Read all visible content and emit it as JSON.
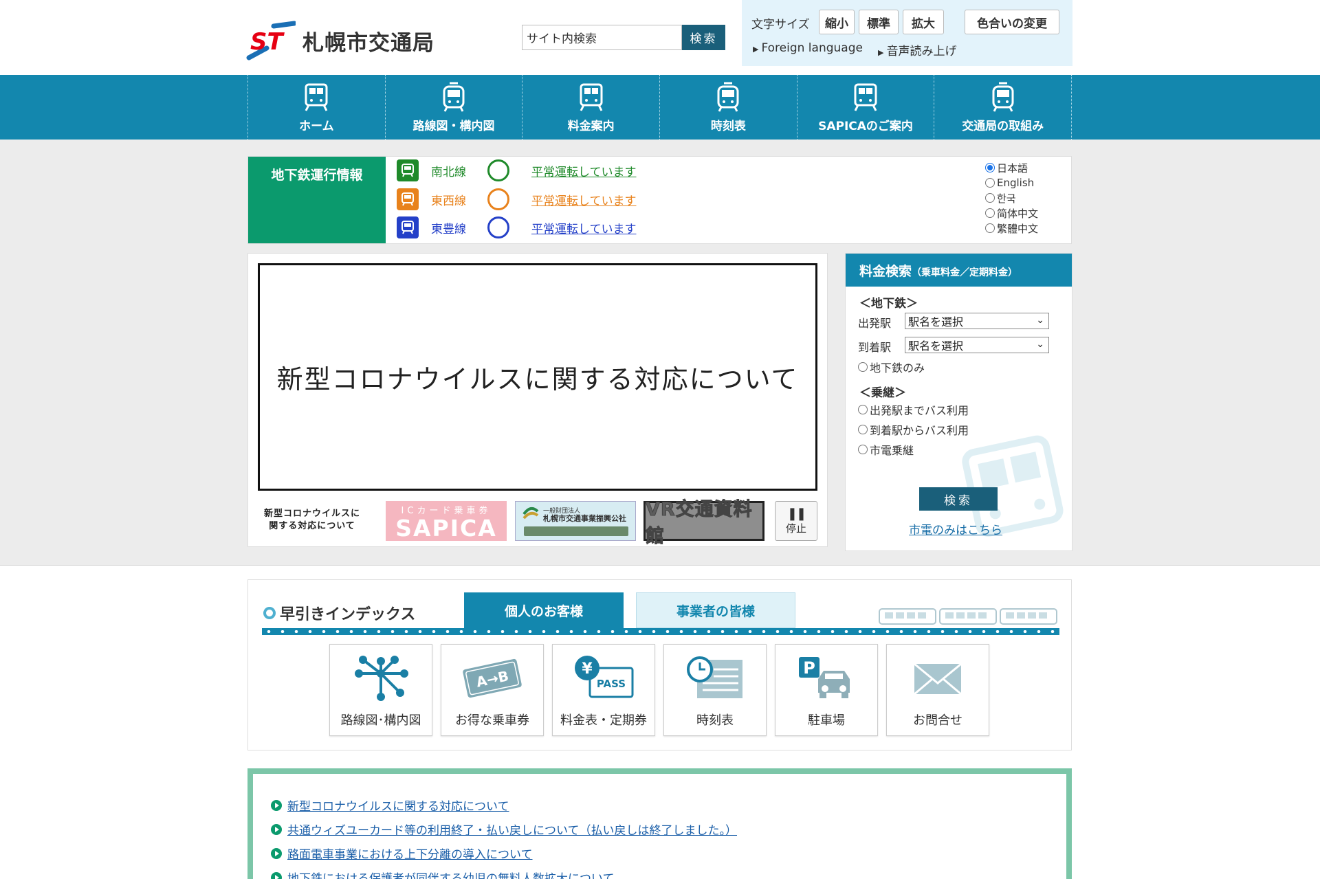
{
  "header": {
    "site_name": "札幌市交通局",
    "logo_letters": "ST",
    "search": {
      "placeholder": "サイト内検索",
      "value": "サイト内検索",
      "button": "検索"
    },
    "font_size": {
      "label": "文字サイズ",
      "small": "縮小",
      "standard": "標準",
      "large": "拡大"
    },
    "color_change": "色合いの変更",
    "foreign_language": "Foreign language",
    "read_aloud": "音声読み上げ"
  },
  "nav": {
    "items": [
      {
        "label": "ホーム",
        "icon": "subway-car-icon"
      },
      {
        "label": "路線図・構内図",
        "icon": "streetcar-icon"
      },
      {
        "label": "料金案内",
        "icon": "subway-car-icon"
      },
      {
        "label": "時刻表",
        "icon": "streetcar-icon"
      },
      {
        "label": "SAPICAのご案内",
        "icon": "subway-car-icon"
      },
      {
        "label": "交通局の取組み",
        "icon": "streetcar-icon"
      }
    ]
  },
  "operation": {
    "title": "地下鉄運行情報",
    "lines": [
      {
        "name": "南北線",
        "status": "平常運転しています",
        "color": "#1f8a2a"
      },
      {
        "name": "東西線",
        "status": "平常運転しています",
        "color": "#e8821c"
      },
      {
        "name": "東豊線",
        "status": "平常運転しています",
        "color": "#2440c8"
      }
    ],
    "languages": [
      {
        "label": "日本語",
        "selected": true
      },
      {
        "label": "English",
        "selected": false
      },
      {
        "label": "한국",
        "selected": false
      },
      {
        "label": "简体中文",
        "selected": false
      },
      {
        "label": "繁體中文",
        "selected": false
      }
    ]
  },
  "slideshow": {
    "main_text": "新型コロナウイルスに関する対応について",
    "thumbs": {
      "covid": "新型コロナウイルスに関する対応について",
      "sapica_sub": "ICカード乗車券",
      "sapica": "SAPICA",
      "kosha_sub": "一般財団法人",
      "kosha": "札幌市交通事業振興公社",
      "vr": "VR交通資料館"
    },
    "pause_label": "停止"
  },
  "fare": {
    "title": "料金検索",
    "title_sub": "（乗車料金／定期料金）",
    "subway_heading": "＜地下鉄＞",
    "departure_label": "出発駅",
    "arrival_label": "到着駅",
    "station_select": "駅名を選択",
    "subway_only": "地下鉄のみ",
    "transfer_heading": "＜乗継＞",
    "bus_to_departure": "出発駅までバス利用",
    "bus_from_arrival": "到着駅からバス利用",
    "streetcar_transfer": "市電乗継",
    "search_button": "検索",
    "streetcar_only_link": "市電のみはこちら"
  },
  "quick_index": {
    "title": "早引きインデックス",
    "tab_personal": "個人のお客様",
    "tab_business": "事業者の皆様",
    "items": [
      {
        "label": "路線図･構内図",
        "icon": "route-map-icon"
      },
      {
        "label": "お得な乗車券",
        "icon": "ticket-icon"
      },
      {
        "label": "料金表・定期券",
        "icon": "fare-pass-icon"
      },
      {
        "label": "時刻表",
        "icon": "timetable-icon"
      },
      {
        "label": "駐車場",
        "icon": "parking-icon"
      },
      {
        "label": "お問合せ",
        "icon": "mail-icon"
      }
    ],
    "pass_text": "PASS",
    "yen_text": "¥",
    "ticket_text": "A→B",
    "parking_text": "P"
  },
  "news": {
    "items": [
      "新型コロナウイルスに関する対応について",
      "共通ウィズユーカード等の利用終了・払い戻しについて（払い戻しは終了しました。）",
      "路面電車事業における上下分離の導入について",
      "地下鉄における保護者が同伴する幼児の無料人数拡大について"
    ]
  },
  "colors": {
    "nav_blue": "#1387ae",
    "dark_teal": "#1a5f7a",
    "operation_green": "#0b9a6d",
    "news_border": "#7cc6a8",
    "link_blue": "#1a5ea8"
  }
}
